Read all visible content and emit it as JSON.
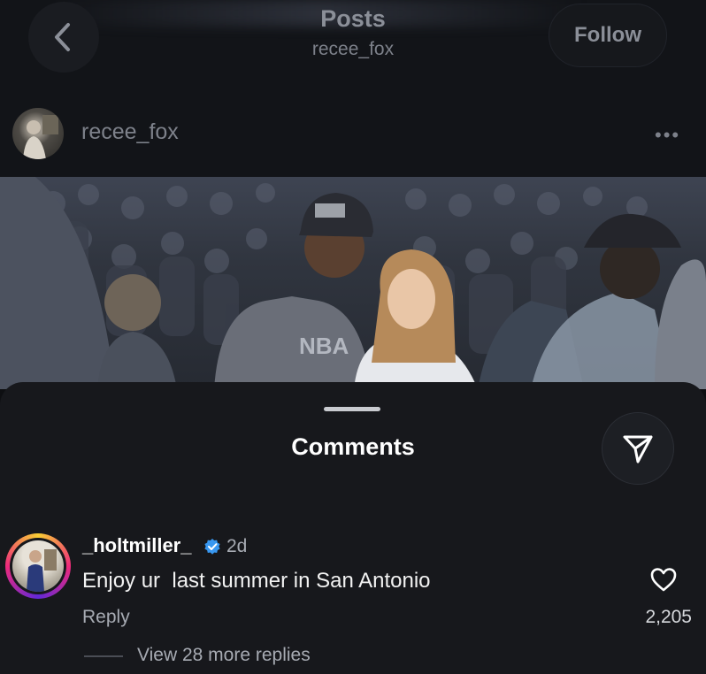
{
  "header": {
    "title": "Posts",
    "subtitle": "recee_fox",
    "follow_label": "Follow"
  },
  "post": {
    "author": "recee_fox",
    "more_label": "•••"
  },
  "comments_sheet": {
    "title": "Comments",
    "comments": [
      {
        "username": "_holtmiller_",
        "verified": true,
        "time": "2d",
        "text": "Enjoy ur  last summer in San Antonio",
        "reply_label": "Reply",
        "likes": "2,205",
        "view_replies": "View 28 more replies"
      }
    ]
  },
  "icons": {
    "back": "chevron-left-icon",
    "more": "more-horizontal-icon",
    "send": "send-icon",
    "verified": "verified-badge-icon",
    "like": "heart-icon"
  },
  "colors": {
    "background": "#0e0f12",
    "sheet": "#17181c",
    "verified_blue": "#3897f0"
  }
}
